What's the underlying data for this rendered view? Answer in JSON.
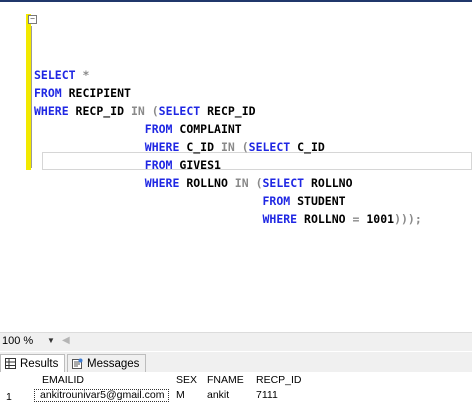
{
  "editor": {
    "lines": [
      [
        {
          "t": "SELECT ",
          "c": "kw"
        },
        {
          "t": "*",
          "c": "gray"
        }
      ],
      [
        {
          "t": "FROM ",
          "c": "kw"
        },
        {
          "t": "RECIPIENT",
          "c": "blk"
        }
      ],
      [
        {
          "t": "WHERE ",
          "c": "kw"
        },
        {
          "t": "RECP_ID ",
          "c": "blk"
        },
        {
          "t": "IN (",
          "c": "gray"
        },
        {
          "t": "SELECT ",
          "c": "kw"
        },
        {
          "t": "RECP_ID",
          "c": "blk"
        }
      ],
      [
        {
          "t": "                FROM ",
          "c": "kw"
        },
        {
          "t": "COMPLAINT",
          "c": "blk"
        }
      ],
      [
        {
          "t": "                WHERE ",
          "c": "kw"
        },
        {
          "t": "C_ID ",
          "c": "blk"
        },
        {
          "t": "IN (",
          "c": "gray"
        },
        {
          "t": "SELECT ",
          "c": "kw"
        },
        {
          "t": "C_ID",
          "c": "blk"
        }
      ],
      [
        {
          "t": "                FROM ",
          "c": "kw"
        },
        {
          "t": "GIVES1",
          "c": "blk"
        }
      ],
      [
        {
          "t": "                WHERE ",
          "c": "kw"
        },
        {
          "t": "ROLLNO ",
          "c": "blk"
        },
        {
          "t": "IN (",
          "c": "gray"
        },
        {
          "t": "SELECT ",
          "c": "kw"
        },
        {
          "t": "ROLLNO",
          "c": "blk"
        }
      ],
      [
        {
          "t": "                                 FROM ",
          "c": "kw"
        },
        {
          "t": "STUDENT",
          "c": "blk"
        }
      ],
      [
        {
          "t": "                                 WHERE ",
          "c": "kw"
        },
        {
          "t": "ROLLNO ",
          "c": "blk"
        },
        {
          "t": "= ",
          "c": "gray"
        },
        {
          "t": "1001",
          "c": "blk"
        },
        {
          "t": ")));",
          "c": "gray"
        }
      ]
    ]
  },
  "zoom": {
    "value": "100 %"
  },
  "tabs": {
    "results": "Results",
    "messages": "Messages"
  },
  "grid": {
    "headers": [
      "EMAILID",
      "SEX",
      "FNAME",
      "RECP_ID"
    ],
    "rows": [
      [
        "1",
        "ankitrounivar5@gmail.com",
        "M",
        "ankit",
        "7111"
      ]
    ]
  }
}
